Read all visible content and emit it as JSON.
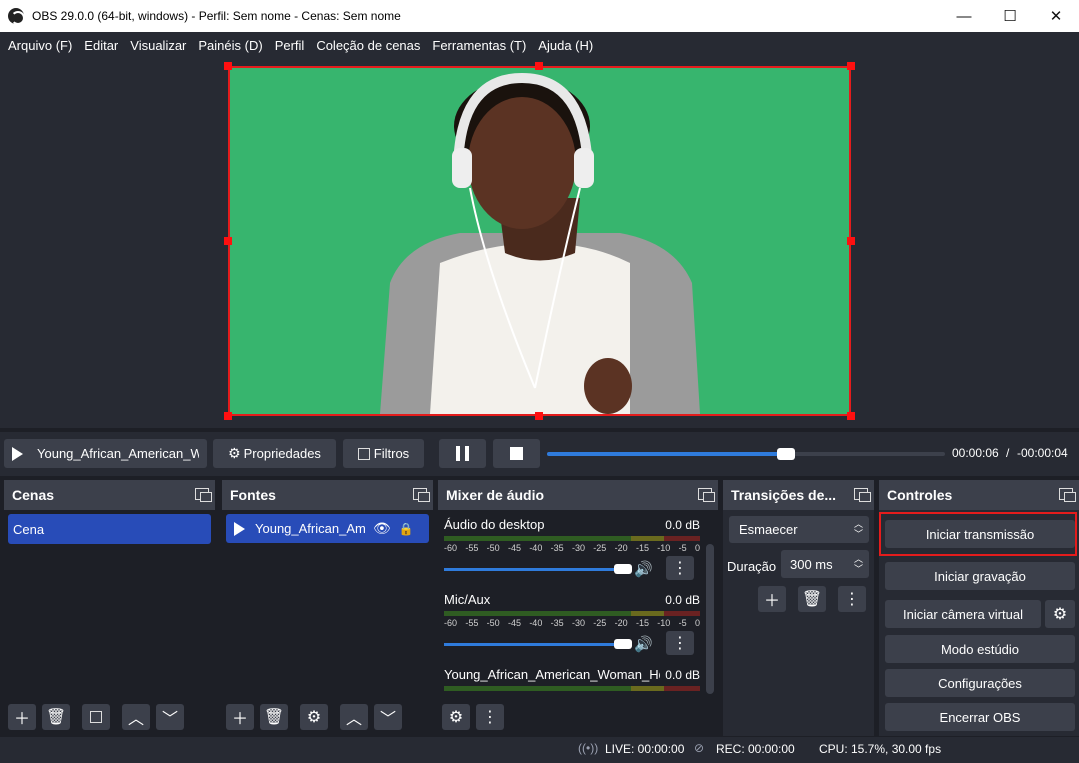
{
  "window": {
    "title": "OBS 29.0.0 (64-bit, windows) - Perfil: Sem nome - Cenas: Sem nome",
    "minimize": "—",
    "maximize": "☐",
    "close": "✕"
  },
  "menu": [
    "Arquivo (F)",
    "Editar",
    "Visualizar",
    "Painéis (D)",
    "Perfil",
    "Coleção de cenas",
    "Ferramentas (T)",
    "Ajuda (H)"
  ],
  "media": {
    "source_name": "Young_African_American_W",
    "properties_label": "Propriedades",
    "filters_label": "Filtros",
    "progress": 0.6,
    "elapsed": "00:00:06",
    "separator": "/",
    "remaining": "-00:00:04"
  },
  "scenes": {
    "title": "Cenas",
    "items": [
      "Cena"
    ]
  },
  "sources": {
    "title": "Fontes",
    "items": [
      "Young_African_Am"
    ]
  },
  "mixer": {
    "title": "Mixer de áudio",
    "scale_labels": [
      "-60",
      "-55",
      "-50",
      "-45",
      "-40",
      "-35",
      "-30",
      "-25",
      "-20",
      "-15",
      "-10",
      "-5",
      "0"
    ],
    "channels": [
      {
        "name": "Áudio do desktop",
        "db": "0.0 dB",
        "volume": 1.0
      },
      {
        "name": "Mic/Aux",
        "db": "0.0 dB",
        "volume": 1.0
      },
      {
        "name": "Young_African_American_Woman_Hd",
        "db": "0.0 dB",
        "volume": 1.0
      }
    ]
  },
  "transitions": {
    "title": "Transições de...",
    "selected": "Esmaecer",
    "duration_label": "Duração",
    "duration_value": "300 ms"
  },
  "controls": {
    "title": "Controles",
    "start_stream": "Iniciar transmissão",
    "start_recording": "Iniciar gravação",
    "start_virtual_cam": "Iniciar câmera virtual",
    "studio_mode": "Modo estúdio",
    "settings": "Configurações",
    "exit": "Encerrar OBS"
  },
  "status": {
    "live": "LIVE: 00:00:00",
    "rec": "REC: 00:00:00",
    "cpu": "CPU: 15.7%, 30.00 fps"
  },
  "colors": {
    "green_screen": "#37b56e",
    "selection_red": "#e41c1c",
    "accent_blue": "#2f7bdc",
    "selected_item": "#284cb8"
  }
}
